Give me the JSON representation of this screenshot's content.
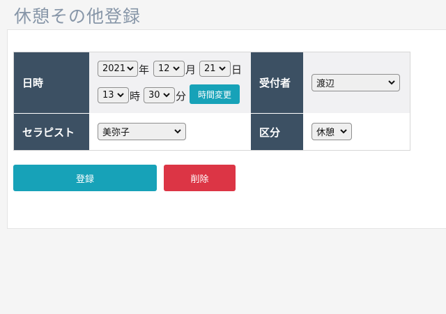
{
  "page": {
    "title": "休憩その他登録"
  },
  "form": {
    "datetime_label": "日時",
    "receptionist_label": "受付者",
    "therapist_label": "セラピスト",
    "category_label": "区分",
    "year": "2021",
    "year_unit": "年",
    "month": "12",
    "month_unit": "月",
    "day": "21",
    "day_unit": "日",
    "hour": "13",
    "hour_unit": "時",
    "minute": "30",
    "minute_unit": "分",
    "change_time_button": "時間変更",
    "receptionist": "渡辺",
    "therapist": "美弥子",
    "category": "休憩"
  },
  "actions": {
    "register": "登録",
    "delete": "削除"
  },
  "colors": {
    "header_bg": "#3c5063",
    "primary": "#17a2b8",
    "danger": "#dc3545"
  },
  "icons": {
    "select_arrow": "chevron-down-icon"
  }
}
